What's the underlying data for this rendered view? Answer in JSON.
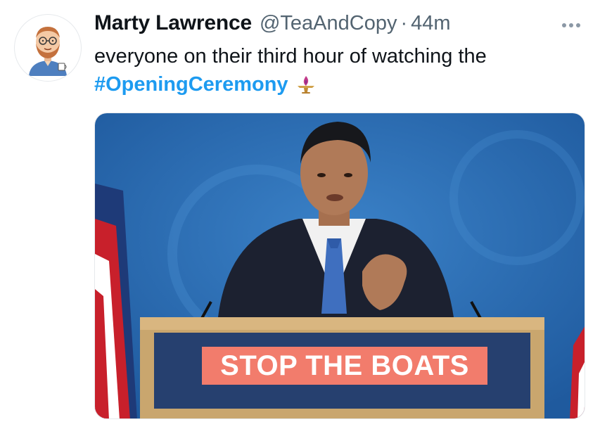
{
  "tweet": {
    "display_name": "Marty Lawrence",
    "handle": "@TeaAndCopy",
    "separator": "·",
    "time": "44m",
    "text_line1": "everyone on their third hour of watching the",
    "hashtag": "#OpeningCeremony",
    "emoji": "olympic-torch-icon"
  },
  "media": {
    "sign_text": "STOP THE BOATS"
  },
  "colors": {
    "hashtag": "#1d9bf0",
    "secondary_text": "#536471",
    "backdrop_blue": "#2f6fb6",
    "sign_red": "#f27c6c"
  }
}
